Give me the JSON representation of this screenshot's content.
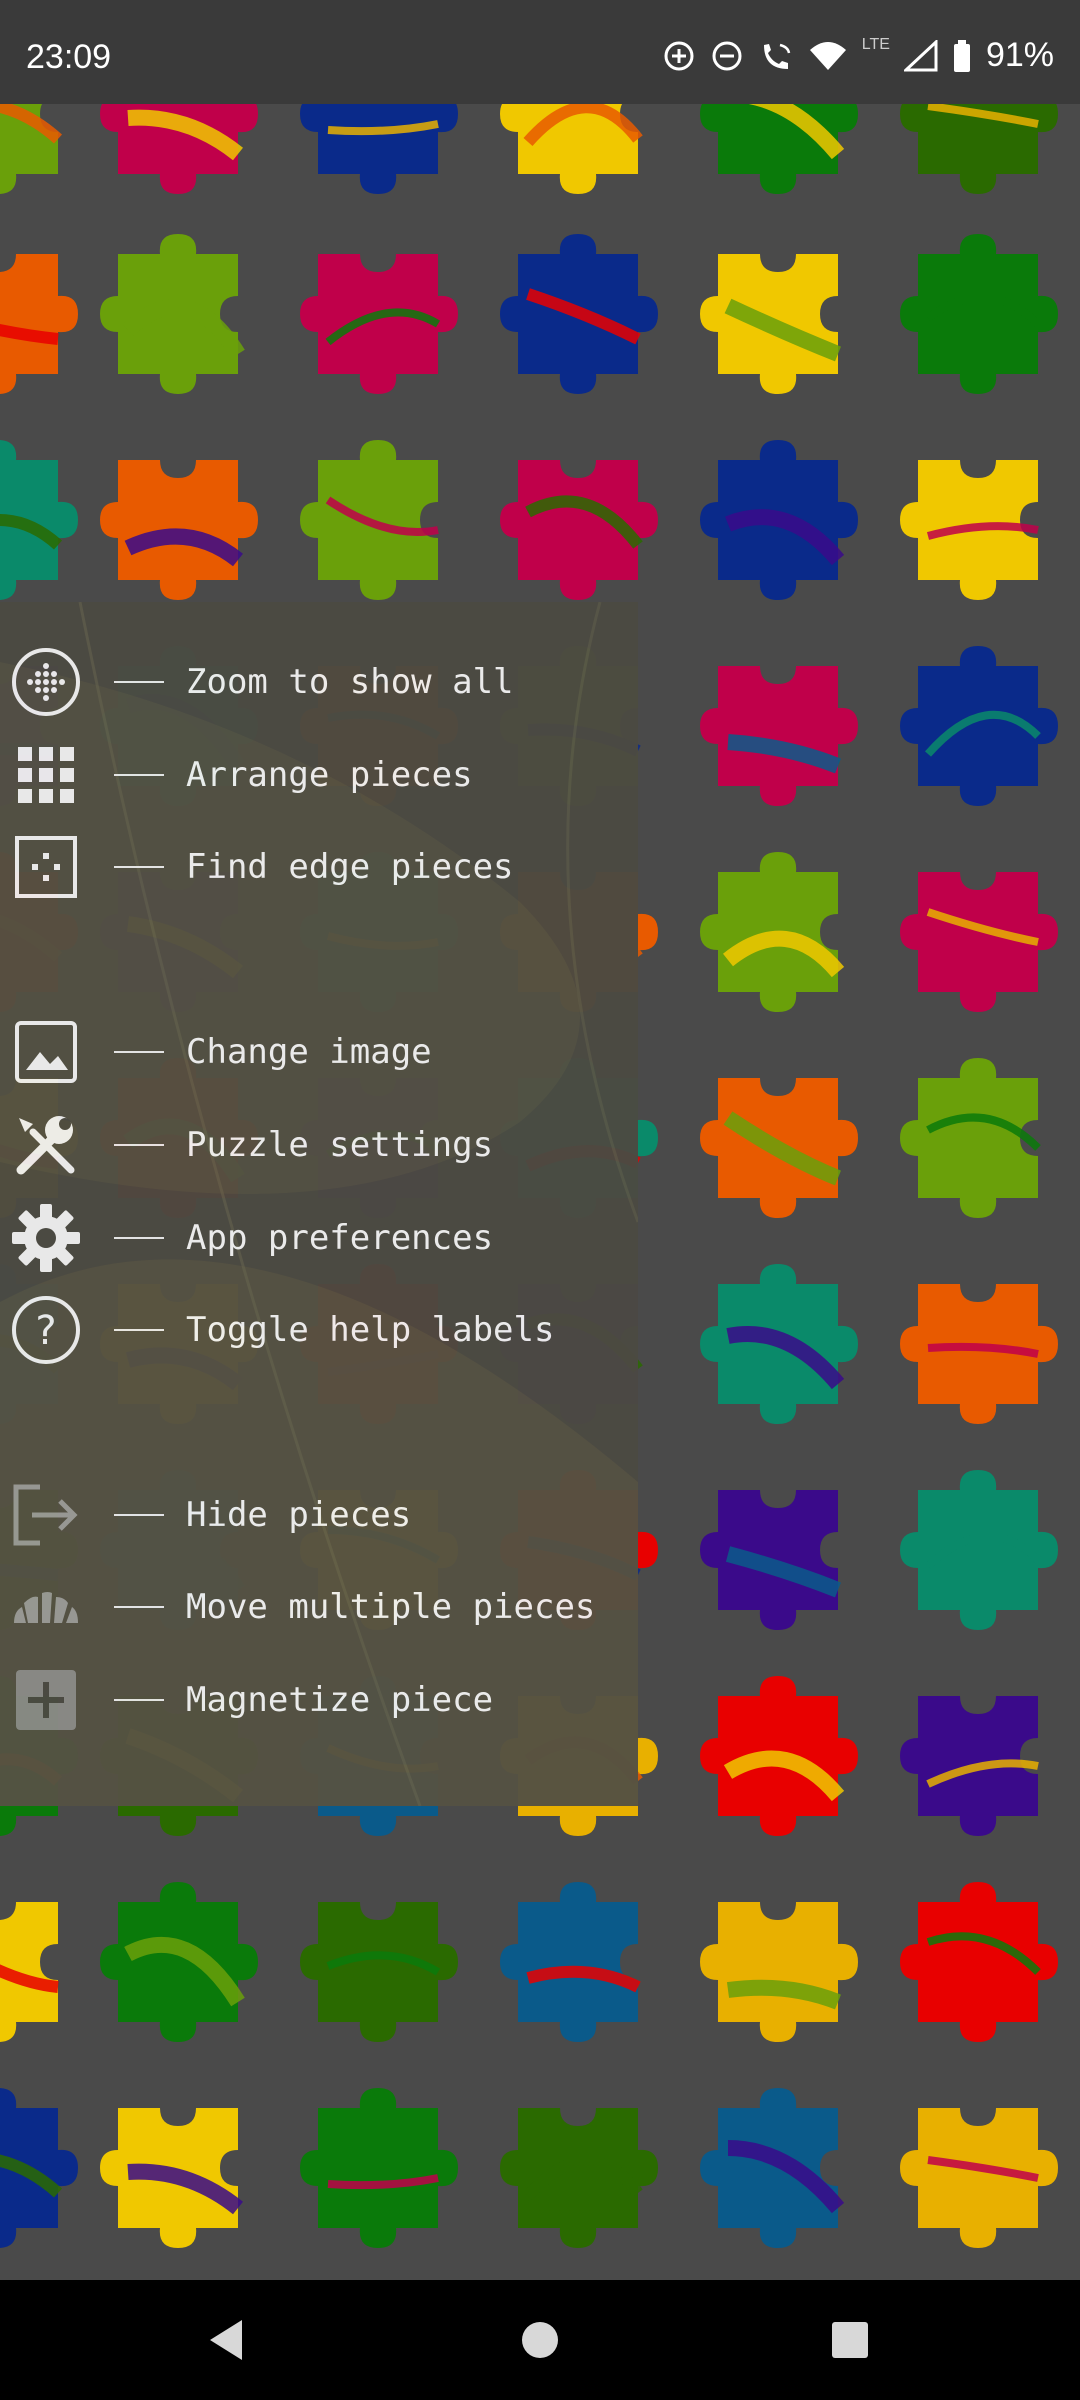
{
  "status_bar": {
    "time": "23:09",
    "network": "LTE",
    "battery": "91%",
    "icons": [
      "data-saver-icon",
      "do-not-disturb-icon",
      "wifi-calling-icon",
      "wifi-icon",
      "signal-icon",
      "battery-icon"
    ]
  },
  "help_menu": {
    "groups": [
      {
        "items": [
          {
            "label": "Zoom to show all",
            "icon": "zoom-all-icon"
          },
          {
            "label": "Arrange pieces",
            "icon": "grid-icon"
          },
          {
            "label": "Find edge pieces",
            "icon": "edge-pieces-icon"
          }
        ]
      },
      {
        "items": [
          {
            "label": "Change image",
            "icon": "image-icon"
          },
          {
            "label": "Puzzle settings",
            "icon": "tools-icon"
          },
          {
            "label": "App preferences",
            "icon": "gear-icon"
          },
          {
            "label": "Toggle help labels",
            "icon": "help-circle-icon"
          }
        ]
      },
      {
        "items": [
          {
            "label": "Hide pieces",
            "icon": "hide-pieces-icon"
          },
          {
            "label": "Move multiple pieces",
            "icon": "multi-move-icon"
          },
          {
            "label": "Magnetize piece",
            "icon": "magnetize-plus-icon"
          }
        ]
      }
    ]
  },
  "colors": {
    "background": "#4a4a4a",
    "panel": "#4c4a42",
    "piece_palette": [
      "#6aa00a",
      "#e8b000",
      "#0a2a8a",
      "#3a0a8a",
      "#0a7a0a",
      "#e85a00",
      "#0a5a8a",
      "#c0004a",
      "#e80000",
      "#f0c800",
      "#0a8a6a",
      "#2a6a00"
    ]
  },
  "nav_bar": {
    "buttons": [
      "back-icon",
      "home-icon",
      "recents-icon"
    ]
  }
}
